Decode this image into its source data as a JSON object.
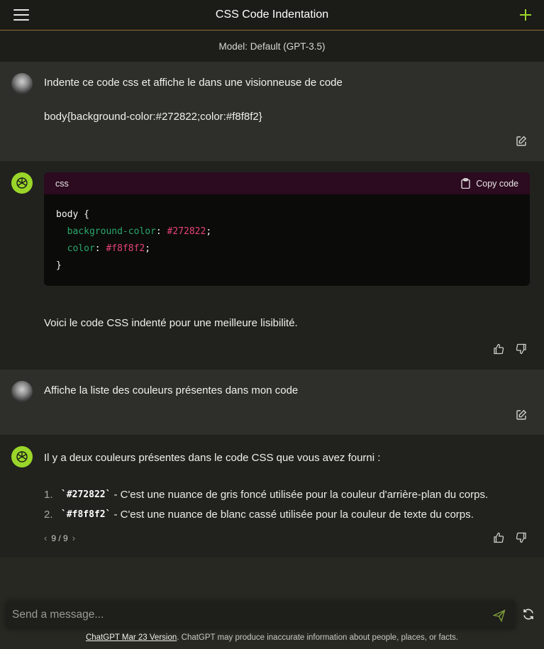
{
  "header": {
    "title": "CSS Code Indentation",
    "menu_icon": "hamburger-icon",
    "new_chat_icon": "plus-icon"
  },
  "model_bar": {
    "label": "Model: Default (GPT-3.5)"
  },
  "messages": [
    {
      "role": "user",
      "lines": [
        "Indente ce code css et affiche le dans une visionneuse de code",
        "body{background-color:#272822;color:#f8f8f2}"
      ],
      "action_icon": "edit-icon"
    },
    {
      "role": "assistant",
      "code_block": {
        "language": "css",
        "copy_label": "Copy code",
        "lines": [
          {
            "parts": [
              [
                "plain",
                "body {"
              ]
            ]
          },
          {
            "parts": [
              [
                "plain",
                "  "
              ],
              [
                "kw",
                "background-color"
              ],
              [
                "plain",
                ": "
              ],
              [
                "val",
                "#272822"
              ],
              [
                "plain",
                ";"
              ]
            ]
          },
          {
            "parts": [
              [
                "plain",
                "  "
              ],
              [
                "kw",
                "color"
              ],
              [
                "plain",
                ": "
              ],
              [
                "val",
                "#f8f8f2"
              ],
              [
                "plain",
                ";"
              ]
            ]
          },
          {
            "parts": [
              [
                "plain",
                "}"
              ]
            ]
          }
        ]
      },
      "text": "Voici le code CSS indenté pour une meilleure lisibilité.",
      "action_icons": [
        "thumbs-up-icon",
        "thumbs-down-icon"
      ]
    },
    {
      "role": "user",
      "lines": [
        "Affiche la liste des couleurs présentes dans mon code"
      ],
      "action_icon": "edit-icon"
    },
    {
      "role": "assistant",
      "intro": "Il y a deux couleurs présentes dans le code CSS que vous avez fourni :",
      "list": [
        {
          "num": "1.",
          "code": "`#272822`",
          "text": " - C'est une nuance de gris foncé utilisée pour la couleur d'arrière-plan du corps."
        },
        {
          "num": "2.",
          "code": "`#f8f8f2`",
          "text": " - C'est une nuance de blanc cassé utilisée pour la couleur de texte du corps."
        }
      ],
      "pager": {
        "prev": "‹",
        "label": "9 / 9",
        "next": "›"
      },
      "action_icons": [
        "thumbs-up-icon",
        "thumbs-down-icon"
      ]
    }
  ],
  "composer": {
    "placeholder": "Send a message...",
    "send_icon": "send-icon",
    "refresh_icon": "refresh-icon"
  },
  "footer": {
    "link_text": "ChatGPT Mar 23 Version",
    "text": ". ChatGPT may produce inaccurate information about people, places, or facts."
  },
  "colors": {
    "background": "#272822",
    "accent_green": "#9ad629",
    "code_keyword": "#29a86a",
    "code_value": "#e6427a",
    "code_header": "#2c0a1f"
  }
}
